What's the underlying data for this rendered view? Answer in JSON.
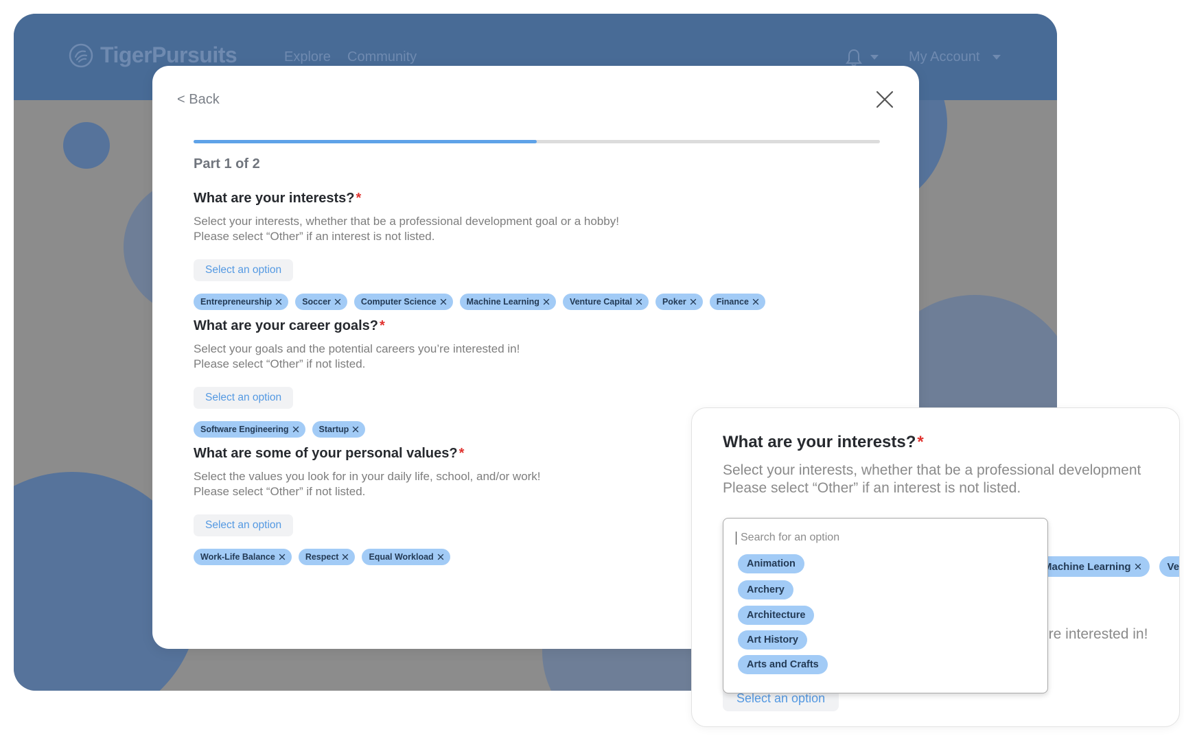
{
  "app": {
    "brand": "TigerPursuits",
    "nav": [
      "Explore",
      "Community"
    ],
    "account_label": "My Account"
  },
  "modal": {
    "back_label": "< Back",
    "progress_fraction": 0.5,
    "part_label": "Part 1 of 2",
    "questions": [
      {
        "title": "What are your interests?",
        "required_mark": "*",
        "desc_line1": "Select your interests, whether that be a professional development goal or a hobby!",
        "desc_line2": "Please select “Other” if an interest is not listed.",
        "select_label": "Select an option",
        "chips": [
          "Entrepreneurship",
          "Soccer",
          "Computer Science",
          "Machine Learning",
          "Venture Capital",
          "Poker",
          "Finance"
        ]
      },
      {
        "title": "What are your career goals?",
        "required_mark": "*",
        "desc_line1": "Select your goals and the potential careers you’re interested in!",
        "desc_line2": "Please select “Other” if not listed.",
        "select_label": "Select an option",
        "chips": [
          "Software Engineering",
          "Startup"
        ]
      },
      {
        "title": "What are some of your personal values?",
        "required_mark": "*",
        "desc_line1": "Select the values you look for in your daily life, school, and/or work!",
        "desc_line2": "Please select “Other” if not listed.",
        "select_label": "Select an option",
        "chips": [
          "Work-Life Balance",
          "Respect",
          "Equal Workload"
        ]
      }
    ]
  },
  "zoom": {
    "title": "What are your interests?",
    "required_mark": "*",
    "desc_line1": "Select your interests, whether that be a professional development",
    "desc_line2": "Please select “Other” if an interest is not listed.",
    "behind_chips": [
      "Machine Learning",
      "Ve"
    ],
    "behind_text": "’re interested in!",
    "select_label": "Select an option",
    "search_placeholder": "Search for an option",
    "options": [
      "Animation",
      "Archery",
      "Architecture",
      "Art History",
      "Arts and Crafts"
    ]
  },
  "colors": {
    "header": "#486b96",
    "accent": "#5ea2e8",
    "chip": "#a2cbf6",
    "required": "#e0322e"
  },
  "icons": [
    "logo-icon",
    "bell-icon",
    "chevron-down-icon",
    "close-icon",
    "chip-remove-icon"
  ]
}
